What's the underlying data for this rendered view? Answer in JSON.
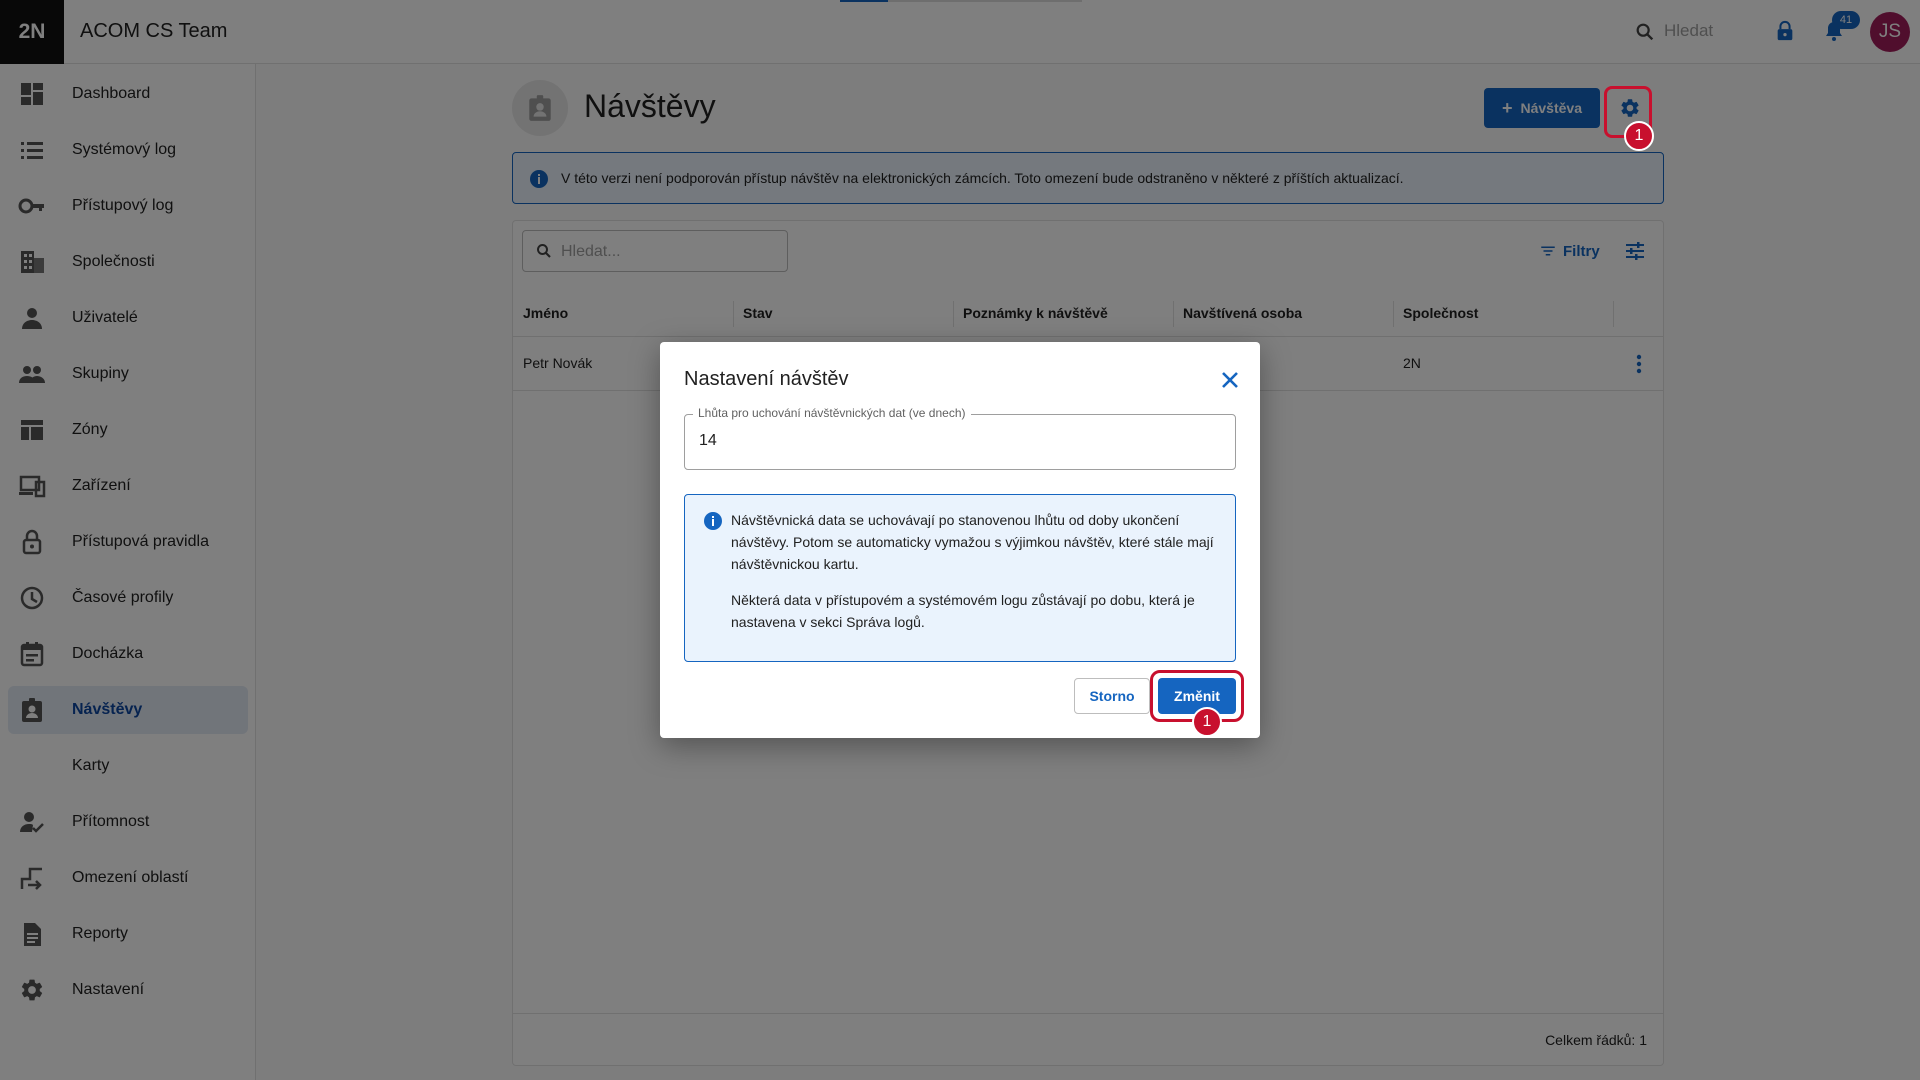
{
  "app": {
    "logo": "2N",
    "title": "ACOM CS Team",
    "search_placeholder": "Hledat",
    "notification_count": "41",
    "user_initials": "JS"
  },
  "sidebar": {
    "items": [
      {
        "label": "Dashboard",
        "icon": "dashboard-icon"
      },
      {
        "label": "Systémový log",
        "icon": "list-icon"
      },
      {
        "label": "Přístupový log",
        "icon": "key-icon"
      },
      {
        "label": "Společnosti",
        "icon": "building-icon"
      },
      {
        "label": "Uživatelé",
        "icon": "person-icon"
      },
      {
        "label": "Skupiny",
        "icon": "group-icon"
      },
      {
        "label": "Zóny",
        "icon": "zones-icon"
      },
      {
        "label": "Zařízení",
        "icon": "devices-icon"
      },
      {
        "label": "Přístupová pravidla",
        "icon": "lock-icon"
      },
      {
        "label": "Časové profily",
        "icon": "clock-icon"
      },
      {
        "label": "Docházka",
        "icon": "calendar-icon"
      },
      {
        "label": "Návštěvy",
        "icon": "badge-icon",
        "active": true
      },
      {
        "label": "Karty",
        "icon": ""
      },
      {
        "label": "Přítomnost",
        "icon": "person-check-icon"
      },
      {
        "label": "Omezení oblastí",
        "icon": "area-restriction-icon"
      },
      {
        "label": "Reporty",
        "icon": "report-icon"
      },
      {
        "label": "Nastavení",
        "icon": "gear-icon"
      }
    ]
  },
  "page": {
    "title": "Návštěvy",
    "new_button": "Návštěva",
    "step_badge": "1",
    "info_banner": "V této verzi není podporován přístup návštěv na elektronických zámcích. Toto omezení bude odstraněno v některé z příštích aktualizací."
  },
  "table": {
    "search_placeholder": "Hledat...",
    "filters_label": "Filtry",
    "columns": [
      "Jméno",
      "Stav",
      "Poznámky k návštěvě",
      "Navštívená osoba",
      "Společnost"
    ],
    "rows": [
      {
        "name": "Petr Novák",
        "company": "2N"
      }
    ],
    "footer": "Celkem řádků: 1"
  },
  "dialog": {
    "title": "Nastavení návštěv",
    "field_label": "Lhůta pro uchování návštěvnických dat (ve dnech)",
    "field_value": "14",
    "info_lines_1": [
      "Návštěvnická data se uchovávají po stanovenou lhůtu od doby ukončení",
      "návštěvy. Potom se automaticky vymažou s výjimkou návštěv, které stále mají",
      "návštěvnickou kartu."
    ],
    "info_lines_2": [
      "Některá data v přístupovém a systémovém logu zůstávají po dobu, která je",
      "nastavena v sekci Správa logů."
    ],
    "cancel": "Storno",
    "confirm": "Změnit",
    "step_badge": "1"
  },
  "colors": {
    "primary": "#1565c0",
    "highlight": "#c8102e",
    "avatar": "#a01c5a"
  }
}
